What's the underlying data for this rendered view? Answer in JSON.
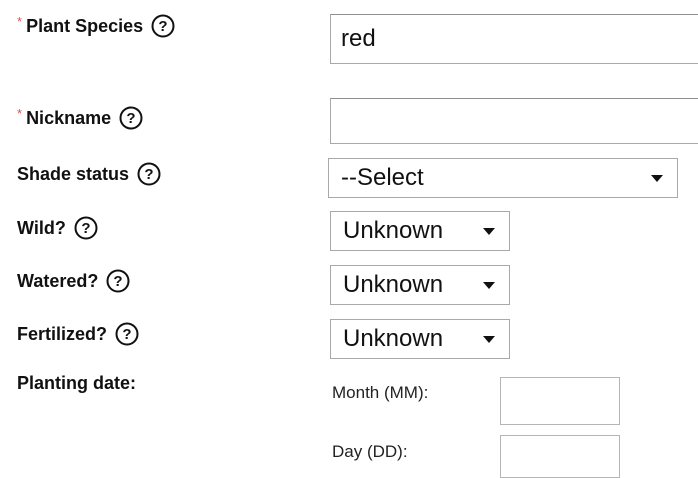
{
  "fields": {
    "plant_species": {
      "required_marker": "*",
      "label": "Plant Species",
      "value": "red"
    },
    "nickname": {
      "required_marker": "*",
      "label": "Nickname",
      "value": ""
    },
    "shade_status": {
      "label": "Shade status",
      "selected": "--Select"
    },
    "wild": {
      "label": "Wild?",
      "selected": "Unknown"
    },
    "watered": {
      "label": "Watered?",
      "selected": "Unknown"
    },
    "fertilized": {
      "label": "Fertilized?",
      "selected": "Unknown"
    },
    "planting_date": {
      "label": "Planting date:",
      "month_label": "Month (MM):",
      "month_value": "",
      "day_label": "Day (DD):",
      "day_value": ""
    }
  },
  "icons": {
    "help": "question-circle-icon",
    "dropdown": "caret-down-icon"
  },
  "colors": {
    "required": "#d9534f",
    "border": "#a9a9a9"
  }
}
